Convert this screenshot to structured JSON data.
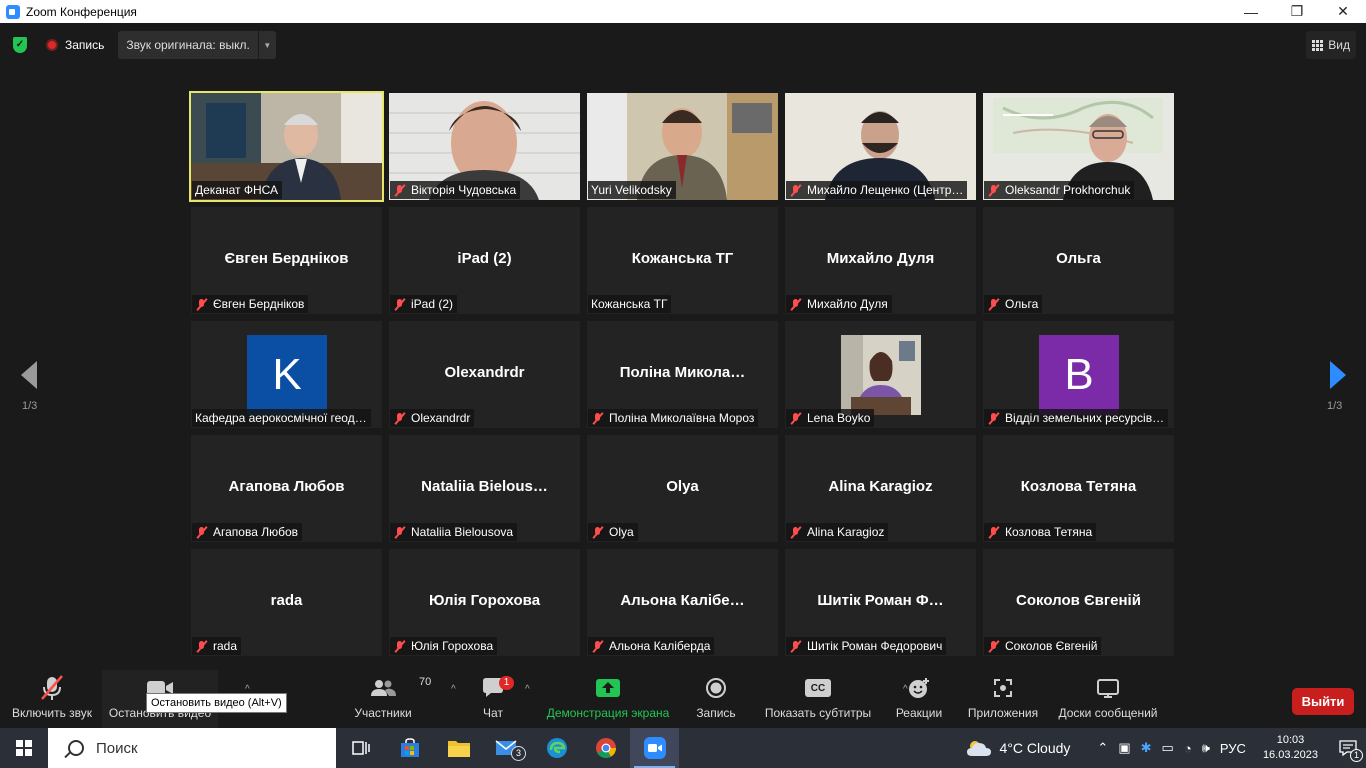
{
  "window": {
    "title": "Zoom Конференция",
    "minimize": "—",
    "restore": "❐",
    "close": "✕"
  },
  "meeting_bar": {
    "security_icon": "shield-check-icon",
    "record_label": "Запись",
    "audio_label": "Звук оригинала: выкл.",
    "view_label": "Вид"
  },
  "navigation": {
    "prev_page": "1/3",
    "next_page": "1/3"
  },
  "tiles": [
    {
      "display": "video",
      "label": "Деканат ФНСА",
      "muted": false,
      "active": true,
      "scene": "office"
    },
    {
      "display": "video",
      "label": "Вікторія Чудовська",
      "muted": true,
      "scene": "brick"
    },
    {
      "display": "video",
      "label": "Yuri Velikodsky",
      "muted": false,
      "scene": "shelf"
    },
    {
      "display": "video",
      "label": "Михайло Лещенко (Центр…",
      "muted": true,
      "scene": "plain"
    },
    {
      "display": "video",
      "label": "Oleksandr Prokhorchuk",
      "muted": true,
      "scene": "map"
    },
    {
      "display": "name",
      "name": "Євген Бердніков",
      "label": "Євген Бердніков",
      "muted": true
    },
    {
      "display": "name",
      "name": "iPad (2)",
      "label": "iPad (2)",
      "muted": true
    },
    {
      "display": "name",
      "name": "Кожанська ТГ",
      "label": "Кожанська ТГ",
      "muted": false
    },
    {
      "display": "name",
      "name": "Михайло Дуля",
      "label": "Михайло Дуля",
      "muted": true
    },
    {
      "display": "name",
      "name": "Ольга",
      "label": "Ольга",
      "muted": true
    },
    {
      "display": "avatar-k",
      "letter": "K",
      "label": "Кафедра аерокосмічної геод…",
      "muted": false
    },
    {
      "display": "name",
      "name": "Olexandrdr",
      "label": "Olexandrdr",
      "muted": true
    },
    {
      "display": "name",
      "name": "Поліна  Микола…",
      "label": "Поліна Миколаївна Мороз",
      "muted": true
    },
    {
      "display": "avatar-photo",
      "label": "Lena Boyko",
      "muted": true
    },
    {
      "display": "avatar-b",
      "letter": "B",
      "label": "Відділ земельних ресурсів…",
      "muted": true
    },
    {
      "display": "name",
      "name": "Агапова Любов",
      "label": "Агапова Любов",
      "muted": true
    },
    {
      "display": "name",
      "name": "Nataliia  Bielous…",
      "label": "Nataliia Bielousova",
      "muted": true
    },
    {
      "display": "name",
      "name": "Olya",
      "label": "Olya",
      "muted": true
    },
    {
      "display": "name",
      "name": "Alina Karagioz",
      "label": "Alina Karagioz",
      "muted": true
    },
    {
      "display": "name",
      "name": "Козлова Тетяна",
      "label": "Козлова Тетяна",
      "muted": true
    },
    {
      "display": "name",
      "name": "rada",
      "label": "rada",
      "muted": true
    },
    {
      "display": "name",
      "name": "Юлія Горохова",
      "label": "Юлія Горохова",
      "muted": true
    },
    {
      "display": "name",
      "name": "Альона  Калібе…",
      "label": "Альона Каліберда",
      "muted": true
    },
    {
      "display": "name",
      "name": "Шитік Роман Ф…",
      "label": "Шитік Роман Федорович",
      "muted": true
    },
    {
      "display": "name",
      "name": "Соколов Євгеній",
      "label": "Соколов Євгеній",
      "muted": true
    }
  ],
  "toolbar": {
    "unmute": "Включить звук",
    "stop_video": "Остановить видео",
    "participants": "Участники",
    "participants_count": "70",
    "chat": "Чат",
    "chat_badge": "1",
    "share": "Демонстрация экрана",
    "record": "Запись",
    "captions": "Показать субтитры",
    "captions_icon_text": "CC",
    "reactions": "Реакции",
    "apps": "Приложения",
    "whiteboards": "Доски сообщений",
    "leave": "Выйти",
    "tooltip": "Остановить видео (Alt+V)",
    "share_color": "#23c552",
    "leave_color": "#c91e1e"
  },
  "taskbar": {
    "search_placeholder": "Поиск",
    "mail_badge": "3",
    "weather": "4°C  Cloudy",
    "language": "РУС",
    "time": "10:03",
    "date": "16.03.2023",
    "notification_count": "1"
  }
}
